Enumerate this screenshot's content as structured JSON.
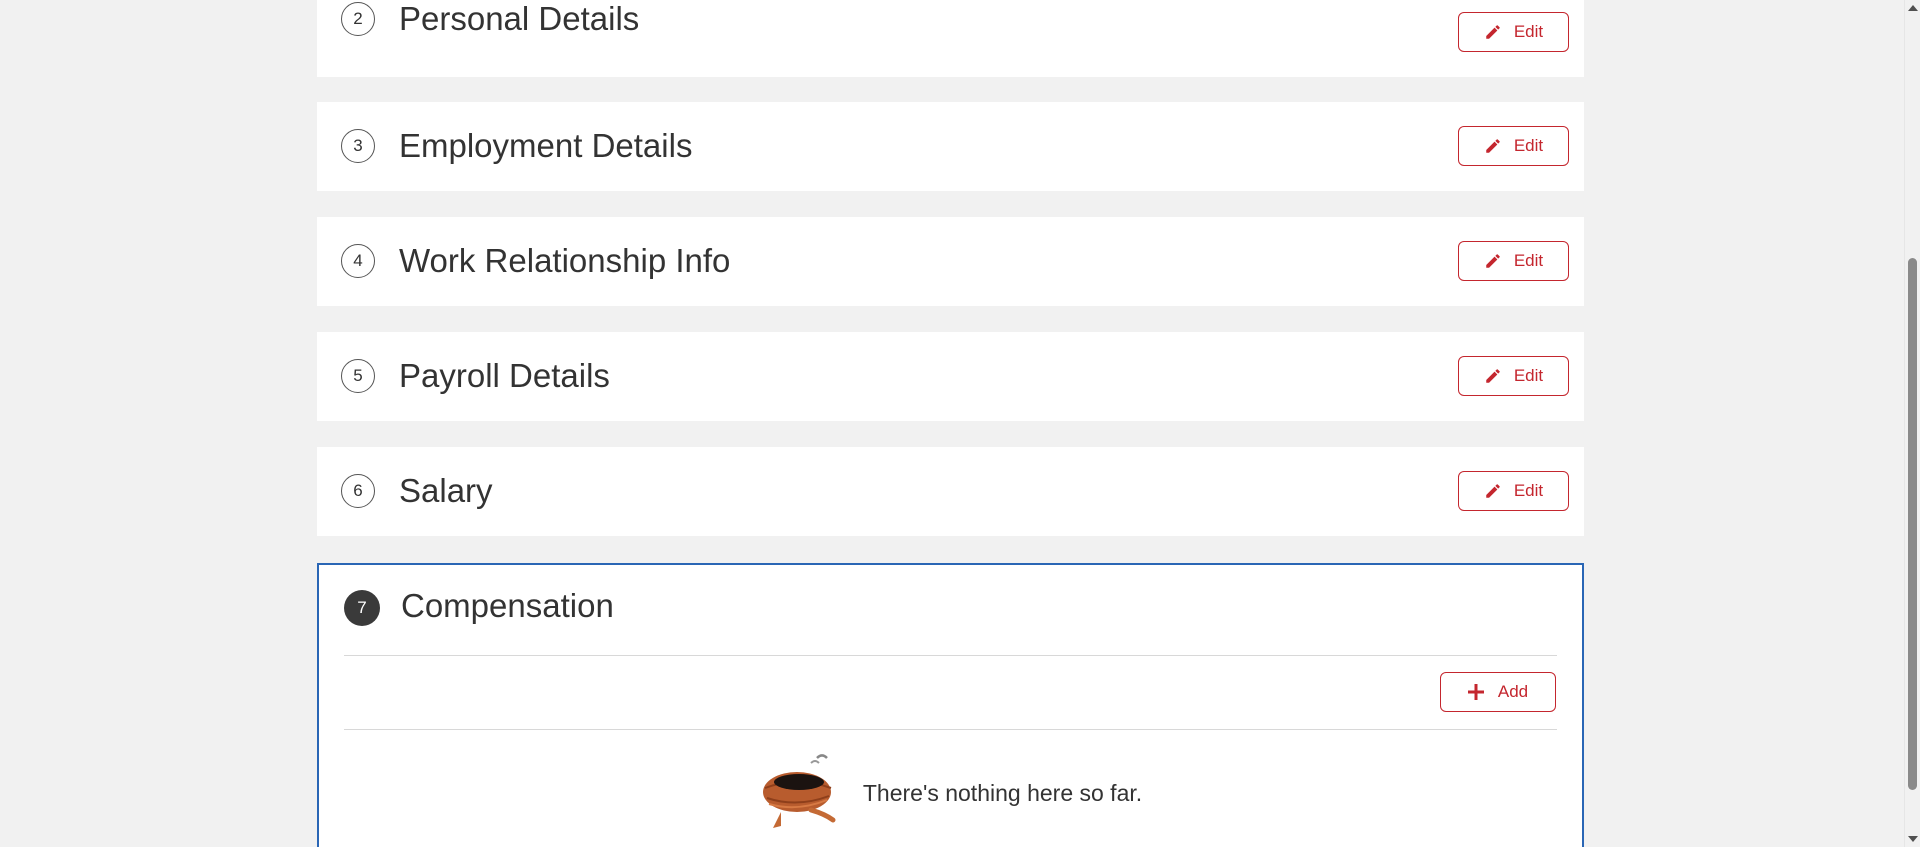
{
  "sections": [
    {
      "step": "2",
      "title": "Personal Details",
      "action": "Edit"
    },
    {
      "step": "3",
      "title": "Employment Details",
      "action": "Edit"
    },
    {
      "step": "4",
      "title": "Work Relationship Info",
      "action": "Edit"
    },
    {
      "step": "5",
      "title": "Payroll Details",
      "action": "Edit"
    },
    {
      "step": "6",
      "title": "Salary",
      "action": "Edit"
    }
  ],
  "active_section": {
    "step": "7",
    "title": "Compensation",
    "add_label": "Add",
    "empty_message": "There's nothing here so far."
  },
  "colors": {
    "accent": "#c4262e",
    "active_border": "#2a66b5",
    "page_bg": "#f1f1f1"
  },
  "icons": {
    "edit": "pencil-icon",
    "add": "plus-icon",
    "empty": "empty-nest-icon"
  }
}
